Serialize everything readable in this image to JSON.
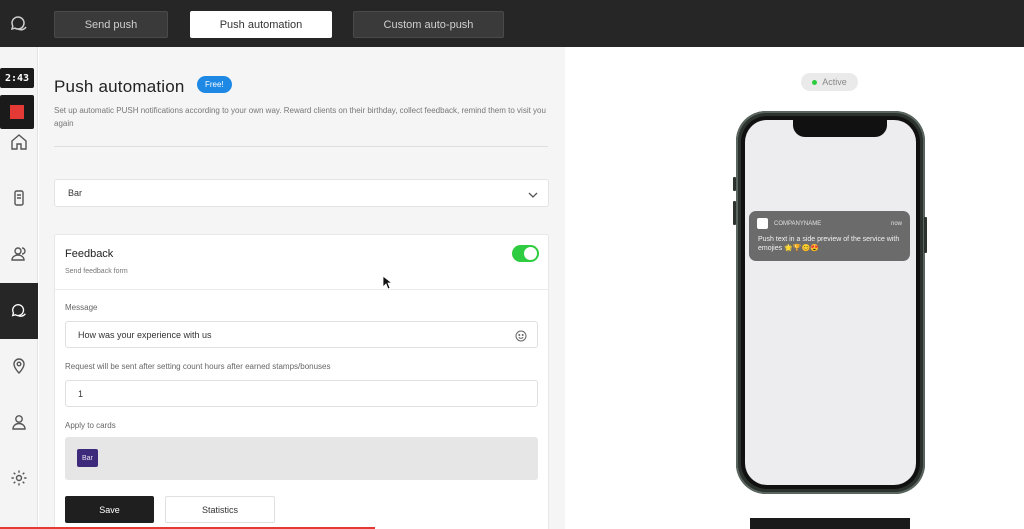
{
  "top_tabs": [
    {
      "label": "Send push",
      "active": false
    },
    {
      "label": "Push automation",
      "active": true
    },
    {
      "label": "Custom auto-push",
      "active": false
    }
  ],
  "recorder": {
    "timer": "2:43"
  },
  "sidebar": {
    "items": [
      {
        "icon": "home-icon"
      },
      {
        "icon": "phone-card-icon"
      },
      {
        "icon": "users-icon"
      },
      {
        "icon": "chat-icon",
        "active": true
      },
      {
        "icon": "location-pin-icon"
      },
      {
        "icon": "user-icon"
      },
      {
        "icon": "gear-icon"
      }
    ]
  },
  "main": {
    "title": "Push automation",
    "badge": "Free!",
    "subtitle": "Set up automatic PUSH notifications according to your own way. Reward clients on their birthday, collect feedback, remind them to visit you again",
    "selected_card": "Bar",
    "feedback": {
      "title": "Feedback",
      "subtitle": "Send feedback form",
      "enabled": true,
      "message_label": "Message",
      "message_value": "How was your experience with us",
      "delay_label": "Request will be sent after setting count hours after earned stamps/bonuses",
      "delay_value": "1",
      "apply_label": "Apply to cards",
      "applied_cards": [
        "Bar"
      ],
      "save_label": "Save",
      "statistics_label": "Statistics"
    }
  },
  "preview": {
    "status": "Active",
    "notification": {
      "company": "COMPANYNAME",
      "time": "now",
      "text": "Push text in a side preview of the service with emojies 🌟🏆😊😍"
    }
  },
  "colors": {
    "accent_blue": "#1e88e5",
    "toggle_green": "#2ecc40",
    "chip_purple": "#3d2a7a",
    "topbar": "#262626"
  }
}
